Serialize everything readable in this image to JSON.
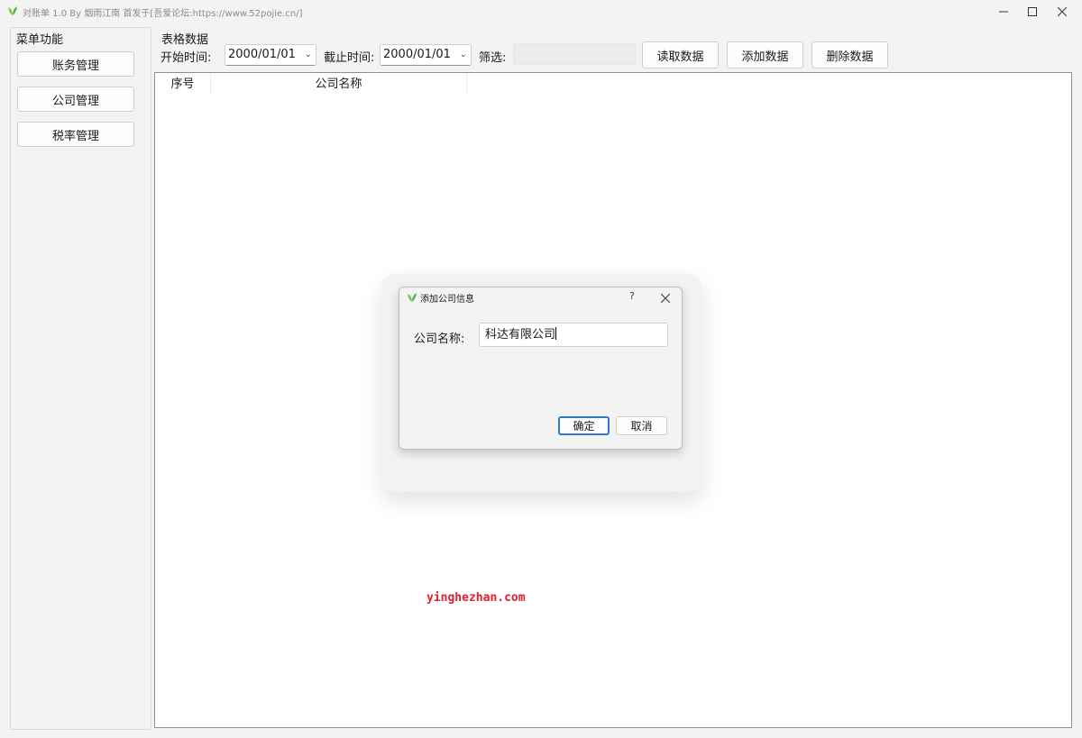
{
  "window": {
    "title": "对账单 1.0 By 烟雨江南 首发于[吾爱论坛:https://www.52pojie.cn/]",
    "icon": "green-leaf-icon",
    "controls": [
      "minimize",
      "maximize",
      "close"
    ],
    "accent_color": "#2f78c8"
  },
  "menu": {
    "title": "菜单功能",
    "items": [
      {
        "label": "账务管理"
      },
      {
        "label": "公司管理"
      },
      {
        "label": "税率管理"
      }
    ]
  },
  "table_section": {
    "title": "表格数据",
    "start_label": "开始时间:",
    "start_value": "2000/01/01",
    "end_label": "截止时间:",
    "end_value": "2000/01/01",
    "filter_label": "筛选:",
    "filter_value": "",
    "buttons": {
      "read": "读取数据",
      "add": "添加数据",
      "delete": "删除数据"
    },
    "columns": [
      "序号",
      "公司名称"
    ],
    "rows": []
  },
  "dialog": {
    "title": "添加公司信息",
    "help": "?",
    "field_label": "公司名称:",
    "field_value": "科达有限公司",
    "ok": "确定",
    "cancel": "取消"
  },
  "watermark": "yinghezhan.com"
}
